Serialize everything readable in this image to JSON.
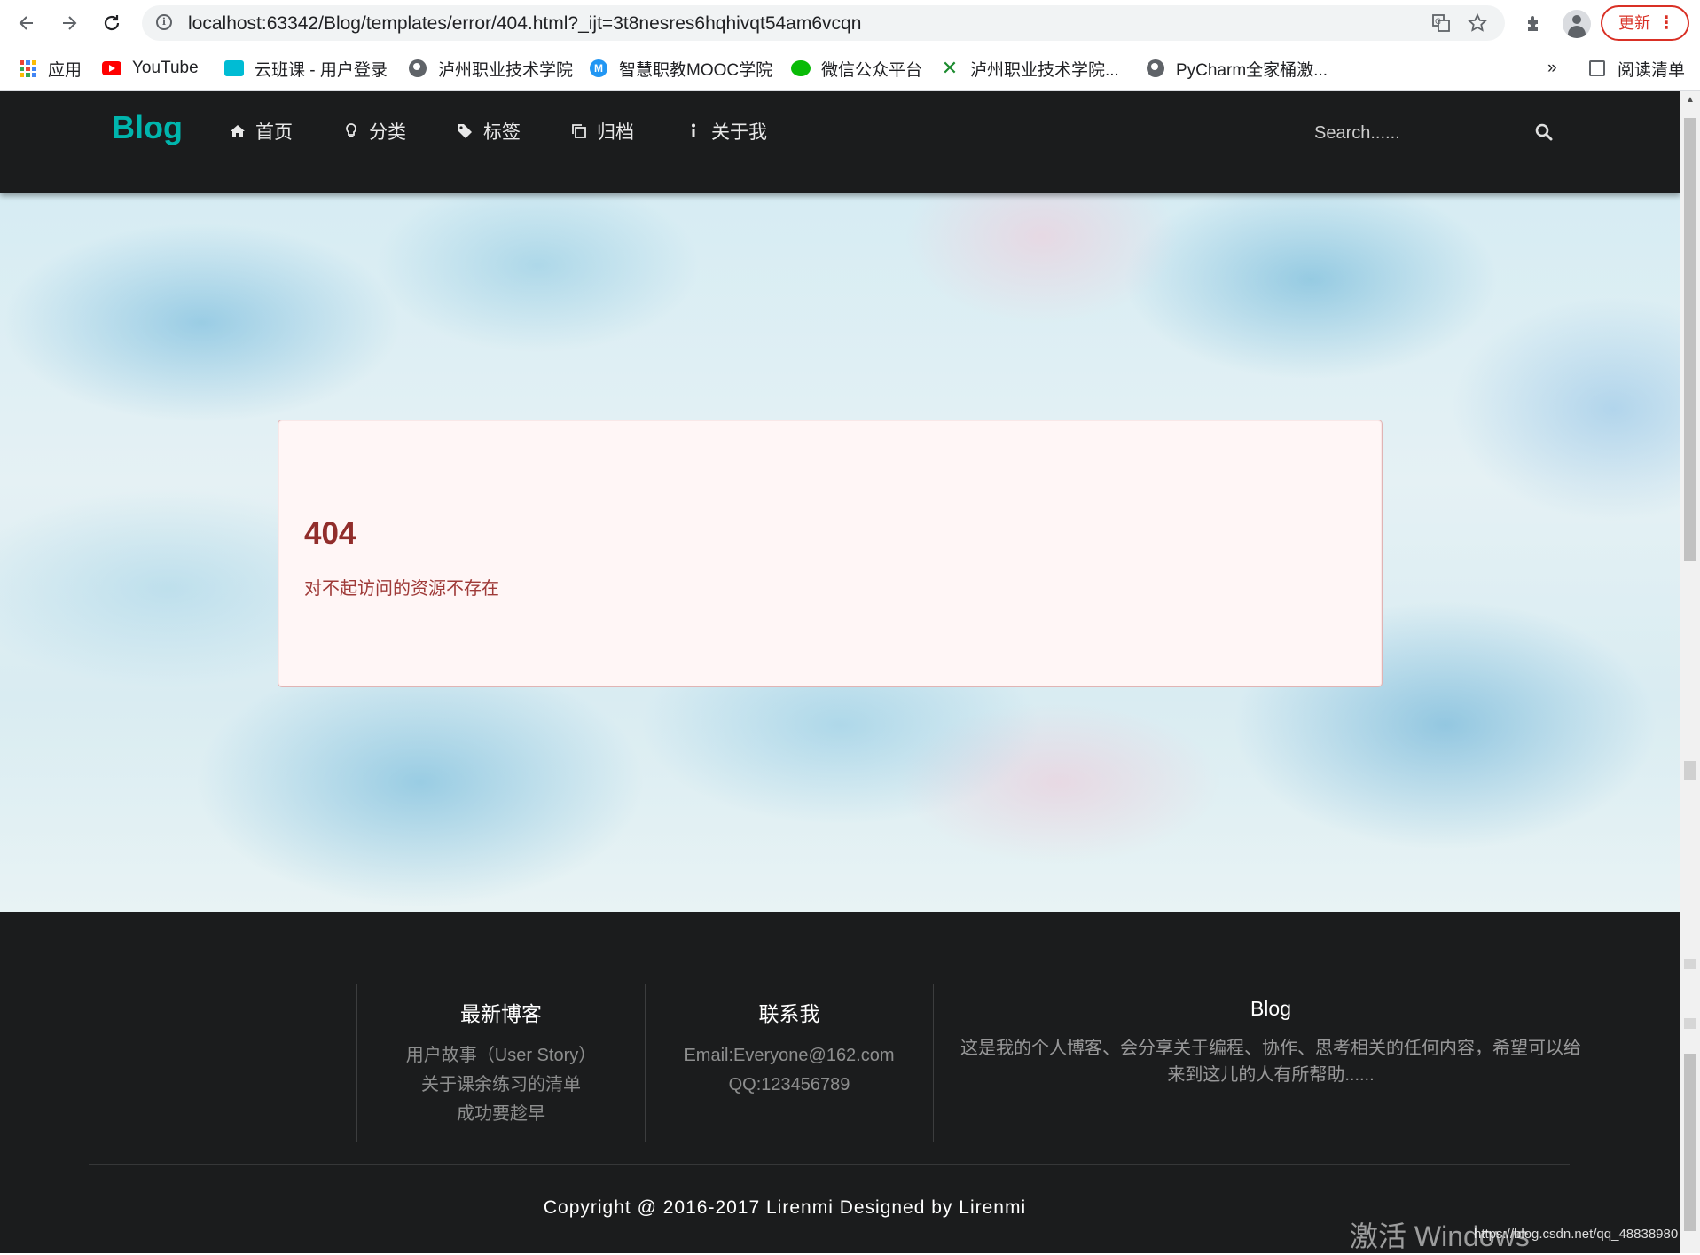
{
  "browser": {
    "url": "localhost:63342/Blog/templates/error/404.html?_ijt=3t8nesres6hqhivqt54am6vcqn",
    "update_label": "更新",
    "bookmarks": [
      {
        "label": "应用",
        "icon": "apps-icon"
      },
      {
        "label": "YouTube",
        "icon": "youtube-icon"
      },
      {
        "label": "云班课 - 用户登录",
        "icon": "cloud-icon"
      },
      {
        "label": "泸州职业技术学院",
        "icon": "globe-icon"
      },
      {
        "label": "智慧职教MOOC学院",
        "icon": "mooc-icon"
      },
      {
        "label": "微信公众平台",
        "icon": "wechat-icon"
      },
      {
        "label": "泸州职业技术学院...",
        "icon": "x-logo-icon"
      },
      {
        "label": "PyCharm全家桶激...",
        "icon": "globe-icon"
      }
    ],
    "more_bookmarks": "»",
    "reading_list": "阅读清单"
  },
  "site": {
    "brand": "Blog",
    "menu": [
      {
        "label": "首页",
        "icon": "home-icon"
      },
      {
        "label": "分类",
        "icon": "lightbulb-icon"
      },
      {
        "label": "标签",
        "icon": "tags-icon"
      },
      {
        "label": "归档",
        "icon": "clone-icon"
      },
      {
        "label": "关于我",
        "icon": "info-icon"
      }
    ],
    "search_placeholder": "Search......"
  },
  "error": {
    "title": "404",
    "message": "对不起访问的资源不存在"
  },
  "footer": {
    "latest": {
      "heading": "最新博客",
      "items": [
        "用户故事（User Story）",
        "关于课余练习的清单",
        "成功要趁早"
      ]
    },
    "contact": {
      "heading": "联系我",
      "items": [
        "Email:Everyone@162.com",
        "QQ:123456789"
      ]
    },
    "about": {
      "heading": "Blog",
      "text": "这是我的个人博客、会分享关于编程、协作、思考相关的任何内容，希望可以给来到这儿的人有所帮助......"
    },
    "copyright": "Copyright @ 2016-2017 Lirenmi Designed by Lirenmi"
  },
  "overlay": {
    "watermark": "激活 Windows",
    "source_url": "https://blog.csdn.net/qq_48838980"
  },
  "colors": {
    "brand": "#00b5ad",
    "nav_bg": "#1b1c1d",
    "error_bg": "#fff6f6",
    "error_text": "#9f3a38"
  }
}
